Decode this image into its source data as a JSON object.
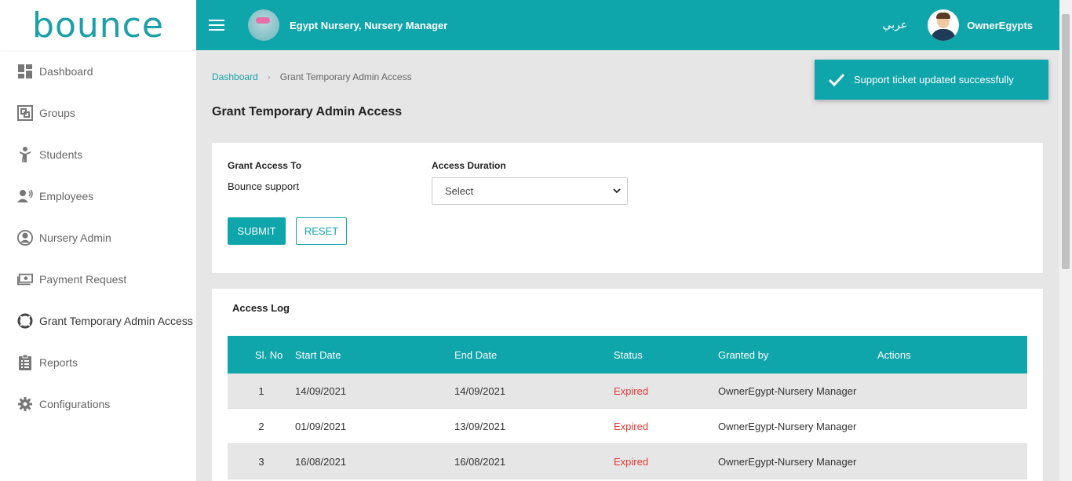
{
  "brand": {
    "logo_text": "bounce"
  },
  "sidebar": {
    "items": [
      {
        "label": "Dashboard",
        "icon": "dashboard-icon"
      },
      {
        "label": "Groups",
        "icon": "groups-icon"
      },
      {
        "label": "Students",
        "icon": "student-icon"
      },
      {
        "label": "Employees",
        "icon": "employees-icon"
      },
      {
        "label": "Nursery Admin",
        "icon": "user-circle-icon"
      },
      {
        "label": "Payment Request",
        "icon": "money-icon"
      },
      {
        "label": "Grant Temporary Admin Access",
        "icon": "lifebuoy-icon"
      },
      {
        "label": "Reports",
        "icon": "clipboard-icon"
      },
      {
        "label": "Configurations",
        "icon": "gear-icon"
      }
    ]
  },
  "header": {
    "org_name": "Egypt Nursery, Nursery Manager",
    "lang_toggle": "عربي",
    "user_name": "OwnerEgypts"
  },
  "breadcrumb": {
    "root": "Dashboard",
    "current": "Grant Temporary Admin Access"
  },
  "page": {
    "title": "Grant Temporary Admin Access"
  },
  "toast": {
    "message": "Support ticket updated successfully"
  },
  "form": {
    "grant_to_label": "Grant Access To",
    "grant_to_value": "Bounce support",
    "duration_label": "Access Duration",
    "duration_selected": "Select",
    "submit_label": "SUBMIT",
    "reset_label": "RESET"
  },
  "access_log": {
    "title": "Access Log",
    "columns": [
      "Sl. No",
      "Start Date",
      "End Date",
      "Status",
      "Granted by",
      "Actions"
    ],
    "rows": [
      {
        "no": "1",
        "start": "14/09/2021",
        "end": "14/09/2021",
        "status": "Expired",
        "granted_by": "OwnerEgypt-Nursery Manager"
      },
      {
        "no": "2",
        "start": "01/09/2021",
        "end": "13/09/2021",
        "status": "Expired",
        "granted_by": "OwnerEgypt-Nursery Manager"
      },
      {
        "no": "3",
        "start": "16/08/2021",
        "end": "16/08/2021",
        "status": "Expired",
        "granted_by": "OwnerEgypt-Nursery Manager"
      }
    ]
  },
  "colors": {
    "accent": "#0ea5ab",
    "expired": "#e53935",
    "logo_dot": "#8cc63f"
  }
}
